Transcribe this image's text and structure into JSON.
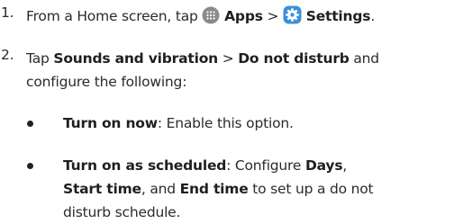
{
  "steps": [
    {
      "number": "1.",
      "lead": "From a Home screen, tap ",
      "apps_label": "Apps",
      "sep": " > ",
      "settings_label": "Settings",
      "end": "."
    },
    {
      "number": "2.",
      "lead": "Tap ",
      "item1": "Sounds and vibration",
      "sep": " > ",
      "item2": "Do not disturb",
      "tail1": " and",
      "line2": "configure the following:"
    }
  ],
  "bullets": [
    {
      "term": "Turn on now",
      "desc": ": Enable this option."
    },
    {
      "term": "Turn on as scheduled",
      "desc1": ": Configure ",
      "days": "Days",
      "comma": ",",
      "start": "Start time",
      "and": ", and ",
      "end": "End time",
      "desc2": " to set up a do not",
      "line3": "disturb schedule."
    }
  ],
  "icons": {
    "apps": "apps-grid-icon",
    "settings": "settings-gear-icon",
    "accent": "#3d8fd8"
  }
}
